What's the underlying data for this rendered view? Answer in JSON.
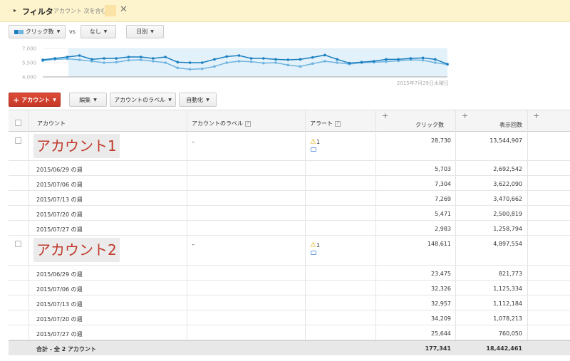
{
  "filter": {
    "title": "フィルタ",
    "condition": "アカウント 次を含む"
  },
  "toolbar": {
    "metric1": "クリック数",
    "vs": "vs",
    "metric2": "なし",
    "period": "日別"
  },
  "chart_data": {
    "type": "line",
    "ylim": [
      4000,
      7000
    ],
    "yticks": [
      "7,000",
      "5,500",
      "4,000"
    ],
    "date_label": "2015年7月29日水曜日",
    "series": [
      {
        "color": "#1a7fbf",
        "values": [
          5800,
          5950,
          6100,
          6250,
          5850,
          5950,
          5950,
          6100,
          6100,
          5950,
          6100,
          5550,
          5500,
          5500,
          5850,
          6150,
          6250,
          5950,
          5950,
          5850,
          5800,
          5850,
          6050,
          6300,
          5850,
          5450,
          5550,
          5650,
          5850,
          5850,
          5950,
          6000,
          5850,
          5350
        ]
      },
      {
        "color": "#6fb3df",
        "values": [
          5700,
          5850,
          5900,
          5800,
          5650,
          5500,
          5550,
          5750,
          5800,
          5650,
          5500,
          4950,
          4800,
          4850,
          5100,
          5500,
          5650,
          5600,
          5450,
          5500,
          5250,
          5100,
          5400,
          5650,
          5500,
          5350,
          5500,
          5550,
          5600,
          5700,
          5800,
          5750,
          5500,
          5300
        ]
      }
    ]
  },
  "add_account_button": "アカウント",
  "actions": {
    "edit": "編集",
    "labels": "アカウントのラベル",
    "automate": "自動化"
  },
  "table": {
    "headers": {
      "account": "アカウント",
      "label": "アカウントのラベル",
      "alert": "アラート",
      "clicks": "クリック数",
      "impressions": "表示回数"
    },
    "accounts": [
      {
        "name": "アカウント1",
        "label": "–",
        "alert_count": "1",
        "clicks": "28,730",
        "impressions": "13,544,907",
        "weeks": [
          {
            "label": "2015/06/29 の週",
            "clicks": "5,703",
            "impressions": "2,692,542"
          },
          {
            "label": "2015/07/06 の週",
            "clicks": "7,304",
            "impressions": "3,622,090"
          },
          {
            "label": "2015/07/13 の週",
            "clicks": "7,269",
            "impressions": "3,470,662"
          },
          {
            "label": "2015/07/20 の週",
            "clicks": "5,471",
            "impressions": "2,500,819"
          },
          {
            "label": "2015/07/27 の週",
            "clicks": "2,983",
            "impressions": "1,258,794"
          }
        ]
      },
      {
        "name": "アカウント2",
        "label": "–",
        "alert_count": "1",
        "clicks": "148,611",
        "impressions": "4,897,554",
        "weeks": [
          {
            "label": "2015/06/29 の週",
            "clicks": "23,475",
            "impressions": "821,773"
          },
          {
            "label": "2015/07/06 の週",
            "clicks": "32,326",
            "impressions": "1,125,334"
          },
          {
            "label": "2015/07/13 の週",
            "clicks": "32,957",
            "impressions": "1,112,184"
          },
          {
            "label": "2015/07/20 の週",
            "clicks": "34,209",
            "impressions": "1,078,213"
          },
          {
            "label": "2015/07/27 の週",
            "clicks": "25,644",
            "impressions": "760,050"
          }
        ]
      }
    ],
    "total": {
      "label": "合計 - 全 2 アカウント",
      "clicks": "177,341",
      "impressions": "18,442,461"
    }
  },
  "colors": {
    "accent_red": "#dd4b39",
    "series_dark": "#1a7fbf",
    "series_light": "#6fb3df",
    "filter_bg": "#fdf3cc"
  }
}
